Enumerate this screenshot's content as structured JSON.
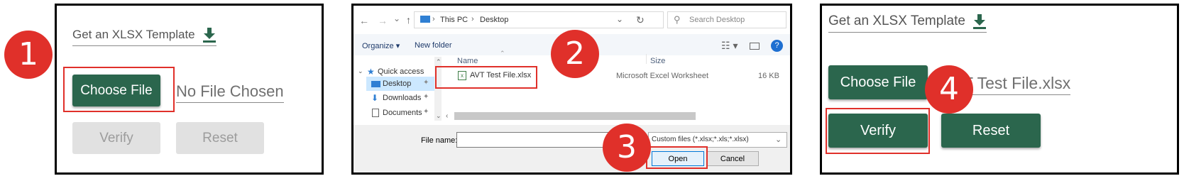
{
  "steps": [
    "1",
    "2",
    "3",
    "4"
  ],
  "panel1": {
    "template_link": "Get an XLSX Template",
    "choose_file": "Choose File",
    "no_file": "No File Chosen",
    "verify": "Verify",
    "reset": "Reset"
  },
  "dialog": {
    "nav_back": "←",
    "nav_forward": "→",
    "nav_recent": "⌄",
    "nav_up": "↑",
    "breadcrumb": [
      "This PC",
      "Desktop"
    ],
    "search_placeholder": "Search Desktop",
    "organize": "Organize ▾",
    "new_folder": "New folder",
    "sidebar": [
      "Quick access",
      "Desktop",
      "Downloads",
      "Documents"
    ],
    "col_name": "Name",
    "col_size": "Size",
    "file": {
      "name": "AVT Test File.xlsx",
      "type": "Microsoft Excel Worksheet",
      "size": "16 KB"
    },
    "file_name_label": "File name:",
    "file_type": "Custom files (*.xlsx;*.xls;*.xlsx)",
    "open": "Open",
    "cancel": "Cancel"
  },
  "panel3": {
    "template_link": "Get an XLSX Template",
    "choose_file": "Choose File",
    "file_chosen": "AVT Test File.xlsx",
    "verify": "Verify",
    "reset": "Reset"
  },
  "colors": {
    "accent_green": "#2b664d",
    "step_red": "#e0302a",
    "highlight_red": "#e0302a"
  }
}
